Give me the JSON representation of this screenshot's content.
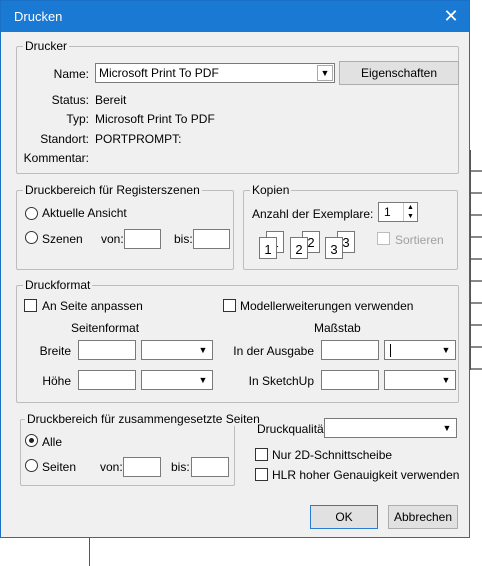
{
  "dialog": {
    "title": "Drucken",
    "close_icon": "close-icon"
  },
  "printer": {
    "legend": "Drucker",
    "name_label": "Name:",
    "name_value": "Microsoft Print To PDF",
    "properties_button": "Eigenschaften",
    "status_label": "Status:",
    "status_value": "Bereit",
    "type_label": "Typ:",
    "type_value": "Microsoft Print To PDF",
    "location_label": "Standort:",
    "location_value": "PORTPROMPT:",
    "comment_label": "Kommentar:",
    "comment_value": ""
  },
  "scene_range": {
    "legend": "Druckbereich für Registerszenen",
    "current_view": "Aktuelle Ansicht",
    "scenes": "Szenen",
    "from_label": "von:",
    "to_label": "bis:",
    "from_value": "",
    "to_value": ""
  },
  "copies": {
    "legend": "Kopien",
    "count_label": "Anzahl der Exemplare:",
    "count_value": "1",
    "collate_label": "Sortieren",
    "collate_glyphs": [
      "1",
      "1",
      "2",
      "2",
      "3",
      "3"
    ]
  },
  "print_format": {
    "legend": "Druckformat",
    "fit_to_page": "An Seite anpassen",
    "model_extents": "Modellerweiterungen verwenden",
    "page_format_heading": "Seitenformat",
    "scale_heading": "Maßstab",
    "width_label": "Breite",
    "height_label": "Höhe",
    "in_output_label": "In der Ausgabe",
    "in_sketchup_label": "In SketchUp"
  },
  "composite_range": {
    "legend": "Druckbereich für zusammengesetzte Seiten",
    "all": "Alle",
    "pages": "Seiten",
    "from_label": "von:",
    "to_label": "bis:"
  },
  "quality": {
    "label": "Druckqualität",
    "value": "",
    "tile_2d": "Nur 2D-Schnittscheibe",
    "hlr": "HLR hoher Genauigkeit verwenden"
  },
  "buttons": {
    "ok": "OK",
    "cancel": "Abbrechen"
  }
}
